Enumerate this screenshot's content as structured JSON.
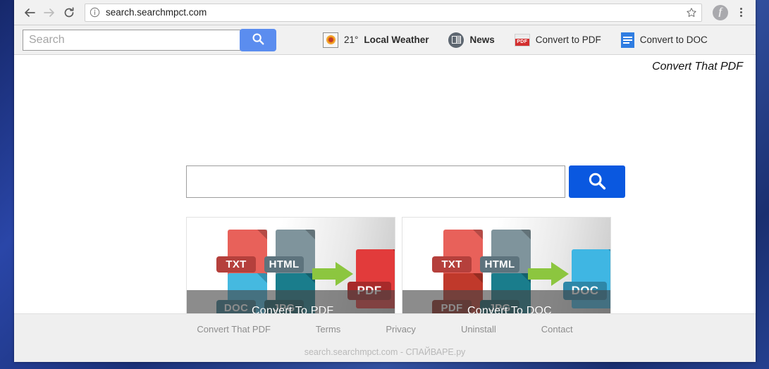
{
  "browser": {
    "back_icon": "back-arrow-icon",
    "forward_icon": "forward-arrow-icon",
    "reload_icon": "reload-icon",
    "url": "search.searchmpct.com",
    "info_icon": "info-circle-icon",
    "bookmark_icon": "star-icon",
    "extension_icon_label": "f",
    "menu_icon": "three-dot-menu-icon"
  },
  "ext_toolbar": {
    "search_placeholder": "Search",
    "search_value": "",
    "search_button_icon": "magnifier-icon",
    "links": [
      {
        "label": "21°",
        "label_bold": "Local Weather",
        "icon": "sun-weather-icon"
      },
      {
        "label": "",
        "label_bold": "News",
        "icon": "newspaper-icon"
      },
      {
        "label": "Convert to PDF",
        "label_bold": "",
        "icon": "pdf-file-icon"
      },
      {
        "label": "Convert to DOC",
        "label_bold": "",
        "icon": "doc-file-icon"
      }
    ]
  },
  "page": {
    "brand_title": "Convert That PDF",
    "search_value": "",
    "search_placeholder": "",
    "search_button_icon": "magnifier-icon",
    "accent_blue": "#0a58e0",
    "toolbar_blue": "#5b8def"
  },
  "promos": [
    {
      "caption": "Convert To PDF",
      "sources": [
        {
          "label": "TXT",
          "color": "#e8615a",
          "badge": "#b5403c"
        },
        {
          "label": "HTML",
          "color": "#7f949c",
          "badge": "#5d737d"
        },
        {
          "label": "DOC",
          "color": "#45b9e0",
          "badge": "#32798f"
        },
        {
          "label": "JPG",
          "color": "#1a7d8c",
          "badge": "#145c67"
        }
      ],
      "target": {
        "label": "PDF",
        "color": "#e23b3b",
        "badge": "#a82a2a"
      },
      "arrow_color": "#8cc63f"
    },
    {
      "caption": "Convert To DOC",
      "sources": [
        {
          "label": "TXT",
          "color": "#e8615a",
          "badge": "#b5403c"
        },
        {
          "label": "HTML",
          "color": "#7f949c",
          "badge": "#5d737d"
        },
        {
          "label": "PDF",
          "color": "#c0392b",
          "badge": "#8e2a20"
        },
        {
          "label": "JPG",
          "color": "#1a7d8c",
          "badge": "#145c67"
        }
      ],
      "target": {
        "label": "DOC",
        "color": "#3fb6e3",
        "badge": "#2e87a8"
      },
      "arrow_color": "#8cc63f"
    }
  ],
  "footer": {
    "links": [
      "Convert That PDF",
      "Terms",
      "Privacy",
      "Uninstall",
      "Contact"
    ],
    "watermark": "search.searchmpct.com - СПАЙВАРЕ.ру"
  }
}
